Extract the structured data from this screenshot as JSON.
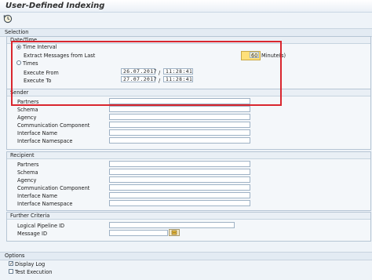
{
  "window": {
    "title": "User-Defined Indexing"
  },
  "toolbar": {
    "execute_icon": "execute-clock-icon"
  },
  "selection": {
    "header": "Selection",
    "datetime": {
      "title": "Date/Time",
      "time_interval_label": "Time Interval",
      "extract_label": "Extract Messages from Last",
      "extract_value": "60",
      "minutes_label": "Minute(s)",
      "times_label": "Times",
      "execute_from_label": "Execute From",
      "execute_from_date": "26.07.2017",
      "execute_from_time": "11:28:41",
      "execute_to_label": "Execute To",
      "execute_to_date": "27.07.2017",
      "execute_to_time": "11:28:41",
      "slash": "/"
    },
    "sender": {
      "title": "Sender",
      "fields": [
        "Partners",
        "Schema",
        "Agency",
        "Communication Component",
        "Interface Name",
        "Interface Namespace"
      ]
    },
    "recipient": {
      "title": "Recipient",
      "fields": [
        "Partners",
        "Schema",
        "Agency",
        "Communication Component",
        "Interface Name",
        "Interface Namespace"
      ]
    },
    "further": {
      "title": "Further Criteria",
      "pipeline_label": "Logical Pipeline ID",
      "message_label": "Message ID"
    }
  },
  "options": {
    "header": "Options",
    "display_log_label": "Display Log",
    "test_execution_label": "Test Execution"
  },
  "colors": {
    "highlight": "#d9262e",
    "input_focus": "#ffe07a"
  }
}
